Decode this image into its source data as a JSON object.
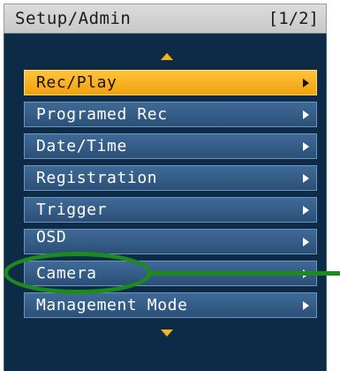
{
  "header": {
    "title": "Setup/Admin",
    "page_indicator": "[1/2]"
  },
  "menu": {
    "items": [
      {
        "label": "Rec/Play"
      },
      {
        "label": "Programed Rec"
      },
      {
        "label": "Date/Time"
      },
      {
        "label": "Registration"
      },
      {
        "label": "Trigger"
      },
      {
        "label": "OSD"
      },
      {
        "label": "Camera"
      },
      {
        "label": "Management Mode"
      }
    ],
    "selected_label": "Rec/Play",
    "annotated_item_label": "Camera"
  },
  "icons": {
    "scroll_up": "triangle-up-icon",
    "scroll_down": "triangle-down-icon",
    "item_arrow": "triangle-right-icon"
  },
  "colors": {
    "panel_background": "#0d2b46",
    "item_background": "#2f5a86",
    "selected_background": "#f6ae1f",
    "annotation": "#1e8a1e",
    "scroll_arrow": "#f2b51c"
  }
}
